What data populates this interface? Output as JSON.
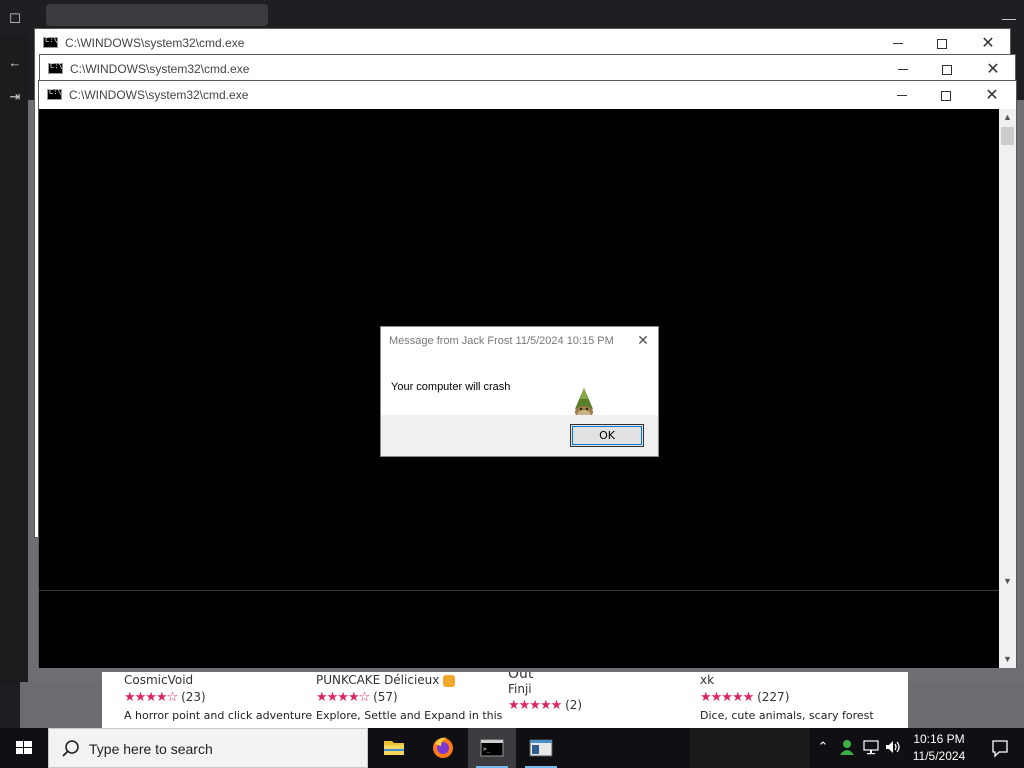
{
  "cmd_windows": [
    {
      "title": "C:\\WINDOWS\\system32\\cmd.exe"
    },
    {
      "title": "C:\\WINDOWS\\system32\\cmd.exe"
    },
    {
      "title": "C:\\WINDOWS\\system32\\cmd.exe"
    }
  ],
  "dialog": {
    "title": "Message from Jack Frost 11/5/2024 10:15 PM",
    "message": "Your computer will crash",
    "ok_label": "OK",
    "close_glyph": "✕"
  },
  "games": [
    {
      "title": "CosmicVoid",
      "stars": "★★★★☆",
      "count": "(23)",
      "desc": "A horror point and click adventure"
    },
    {
      "title": "PUNKCAKE Délicieux",
      "stars": "★★★★☆",
      "count": "(57)",
      "desc": "Explore, Settle and Expand in this"
    },
    {
      "title": "Out",
      "subtitle": "Finji",
      "stars": "★★★★★",
      "count": "(2)",
      "desc": ""
    },
    {
      "title": "xk",
      "stars": "★★★★★",
      "count": "(227)",
      "desc": "Dice, cute animals, scary forest"
    }
  ],
  "taskbar": {
    "search_placeholder": "Type here to search",
    "apps": [
      {
        "name": "file-explorer"
      },
      {
        "name": "firefox"
      },
      {
        "name": "command-prompt"
      },
      {
        "name": "notepad-window"
      }
    ],
    "time": "10:16 PM",
    "date": "11/5/2024"
  },
  "colors": {
    "taskbar": "#101014",
    "console": "#000000",
    "star": "#e0245e",
    "focus": "#0078d7"
  }
}
